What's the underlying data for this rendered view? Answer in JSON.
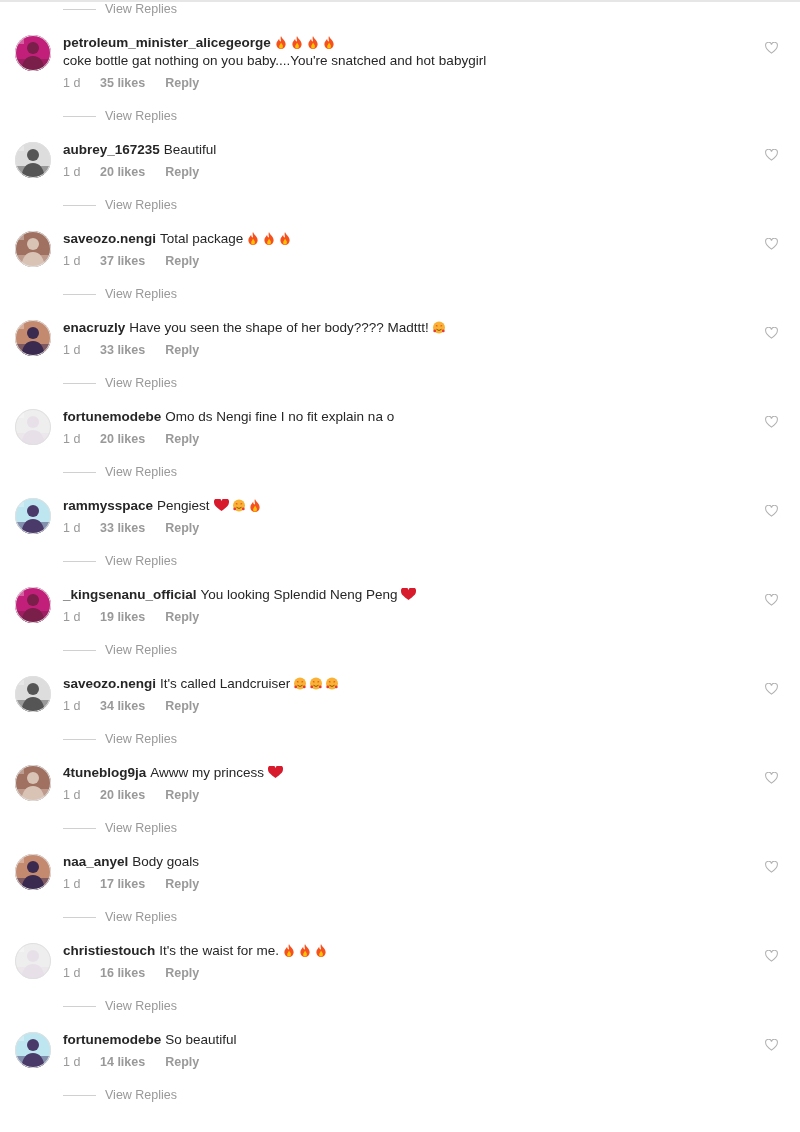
{
  "top_view_replies": "View Replies",
  "comments": [
    {
      "username": "petroleum_minister_alicegeorge",
      "parts": [
        {
          "kind": "fire"
        },
        {
          "kind": "fire"
        },
        {
          "kind": "fire"
        },
        {
          "kind": "fire"
        },
        {
          "kind": "text",
          "text": "coke bottle gat nothing on you baby....You're snatched and hot"
        },
        {
          "kind": "text",
          "text": "babygirl"
        }
      ],
      "time": "1 d",
      "likes": "35 likes",
      "reply": "Reply",
      "liked": false,
      "view_replies": "View Replies"
    },
    {
      "username": "aubrey_167235",
      "parts": [
        {
          "kind": "text",
          "text": "Beautiful"
        }
      ],
      "time": "1 d",
      "likes": "20 likes",
      "reply": "Reply",
      "liked": false,
      "view_replies": "View Replies"
    },
    {
      "username": "saveozo.nengi",
      "parts": [
        {
          "kind": "text",
          "text": "Total package"
        },
        {
          "kind": "fire"
        },
        {
          "kind": "fire"
        },
        {
          "kind": "fire"
        }
      ],
      "time": "1 d",
      "likes": "37 likes",
      "reply": "Reply",
      "liked": false,
      "view_replies": "View Replies"
    },
    {
      "username": "enacruzly",
      "parts": [
        {
          "kind": "text",
          "text": "Have you seen the shape of her body???? Madttt!"
        },
        {
          "kind": "smiley"
        }
      ],
      "time": "1 d",
      "likes": "33 likes",
      "reply": "Reply",
      "liked": false,
      "view_replies": "View Replies"
    },
    {
      "username": "fortunemodebe",
      "parts": [
        {
          "kind": "text",
          "text": "Omo ds Nengi fine I no fit explain na o"
        }
      ],
      "time": "1 d",
      "likes": "20 likes",
      "reply": "Reply",
      "liked": false,
      "view_replies": "View Replies"
    },
    {
      "username": "rammysspace",
      "parts": [
        {
          "kind": "text",
          "text": "Pengiest"
        },
        {
          "kind": "heart"
        },
        {
          "kind": "smiley"
        },
        {
          "kind": "fire"
        }
      ],
      "time": "1 d",
      "likes": "33 likes",
      "reply": "Reply",
      "liked": false,
      "view_replies": "View Replies"
    },
    {
      "username": "_kingsenanu_official",
      "parts": [
        {
          "kind": "text",
          "text": "You looking Splendid Neng Peng"
        },
        {
          "kind": "heart"
        }
      ],
      "time": "1 d",
      "likes": "19 likes",
      "reply": "Reply",
      "liked": false,
      "view_replies": "View Replies"
    },
    {
      "username": "saveozo.nengi",
      "parts": [
        {
          "kind": "text",
          "text": "It's called Landcruiser"
        },
        {
          "kind": "smiley"
        },
        {
          "kind": "smiley"
        },
        {
          "kind": "smiley"
        }
      ],
      "time": "1 d",
      "likes": "34 likes",
      "reply": "Reply",
      "liked": false,
      "view_replies": "View Replies"
    },
    {
      "username": "4tuneblog9ja",
      "parts": [
        {
          "kind": "text",
          "text": "Awww my princess"
        },
        {
          "kind": "heart"
        }
      ],
      "time": "1 d",
      "likes": "20 likes",
      "reply": "Reply",
      "liked": false,
      "view_replies": "View Replies"
    },
    {
      "username": "naa_anyel",
      "parts": [
        {
          "kind": "text",
          "text": "Body goals"
        }
      ],
      "time": "1 d",
      "likes": "17 likes",
      "reply": "Reply",
      "liked": false,
      "view_replies": "View Replies"
    },
    {
      "username": "christiestouch",
      "parts": [
        {
          "kind": "text",
          "text": "It's the waist for me."
        },
        {
          "kind": "fire"
        },
        {
          "kind": "fire"
        },
        {
          "kind": "fire"
        }
      ],
      "time": "1 d",
      "likes": "16 likes",
      "reply": "Reply",
      "liked": false,
      "view_replies": "View Replies"
    },
    {
      "username": "fortunemodebe",
      "parts": [
        {
          "kind": "text",
          "text": "So beautiful"
        }
      ],
      "time": "1 d",
      "likes": "14 likes",
      "reply": "Reply",
      "liked": false,
      "view_replies": "View Replies"
    }
  ]
}
